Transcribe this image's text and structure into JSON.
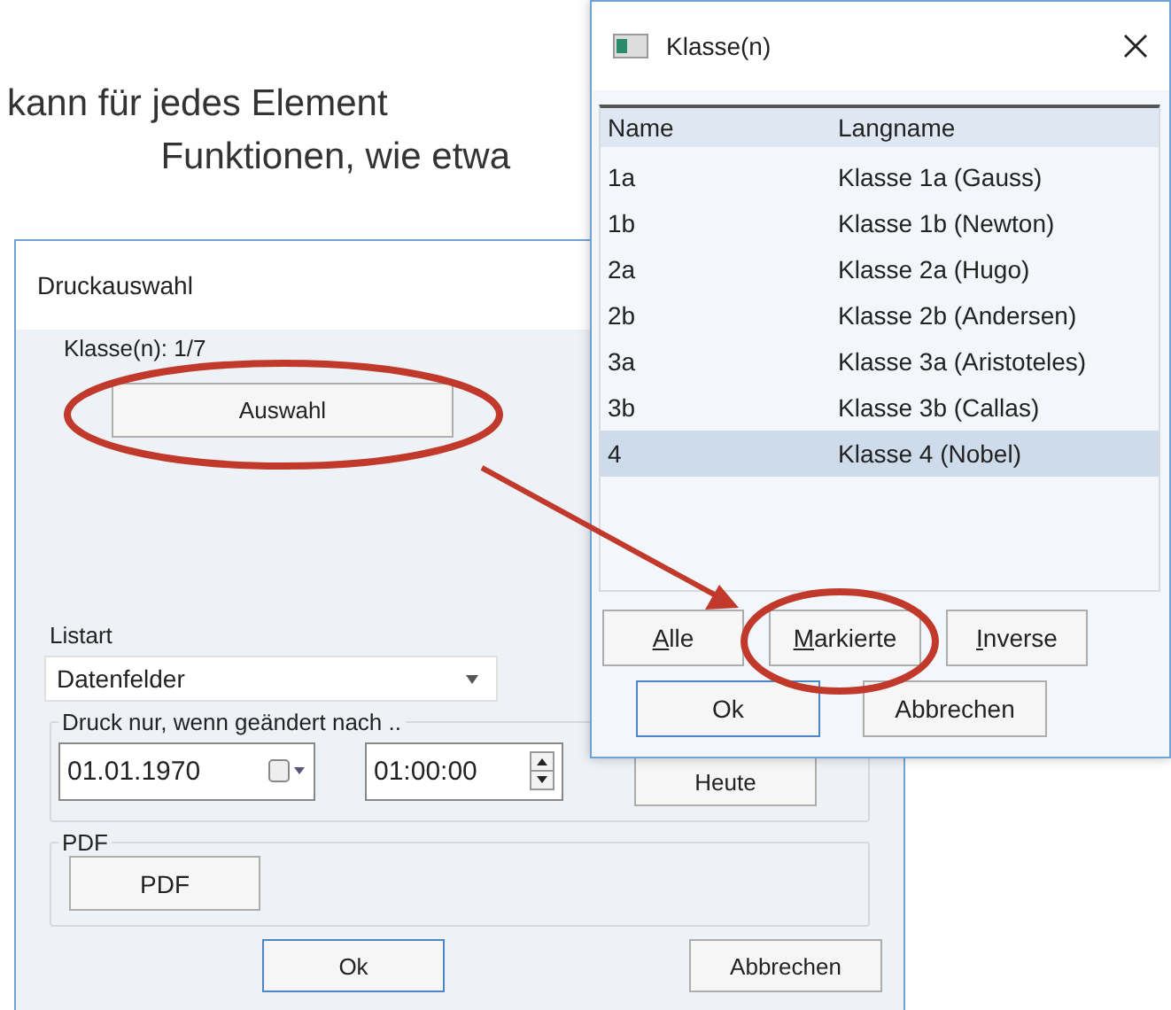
{
  "intro_text": [
    "kann für jedes Element",
    "Funktionen, wie etwa"
  ],
  "print_dialog": {
    "title": "Druckauswahl",
    "class_label": "Klasse(n): 1/7",
    "select_button": "Auswahl",
    "list_type_label": "Listart",
    "list_type": {
      "value": "Datenfelder"
    },
    "changed_group": {
      "label": "Druck nur, wenn geändert nach ..",
      "date": "01.01.1970",
      "time": "01:00:00",
      "today_button": "Heute"
    },
    "pdf_group": {
      "label": "PDF",
      "button": "PDF"
    },
    "buttons": [
      {
        "label": "Ok",
        "default": true
      },
      {
        "label": "Abbrechen",
        "default": false
      }
    ]
  },
  "class_dialog": {
    "title": "Klasse(n)",
    "columns": [
      "Name",
      "Langname"
    ],
    "rows": [
      {
        "name": "1a",
        "long_name": "Klasse 1a (Gauss)",
        "selected": false
      },
      {
        "name": "1b",
        "long_name": "Klasse 1b (Newton)",
        "selected": false
      },
      {
        "name": "2a",
        "long_name": "Klasse 2a (Hugo)",
        "selected": false
      },
      {
        "name": "2b",
        "long_name": "Klasse 2b (Andersen)",
        "selected": false
      },
      {
        "name": "3a",
        "long_name": "Klasse 3a (Aristoteles)",
        "selected": false
      },
      {
        "name": "3b",
        "long_name": "Klasse 3b (Callas)",
        "selected": false
      },
      {
        "name": "4",
        "long_name": "Klasse 4 (Nobel)",
        "selected": true
      }
    ],
    "select_buttons": [
      {
        "label": "Alle",
        "underline_first": true
      },
      {
        "label": "Markierte",
        "underline_first": true
      },
      {
        "label": "Inverse",
        "underline_first": true
      }
    ],
    "buttons": [
      {
        "label": "Ok",
        "default": true
      },
      {
        "label": "Abbrechen",
        "default": false
      }
    ]
  }
}
